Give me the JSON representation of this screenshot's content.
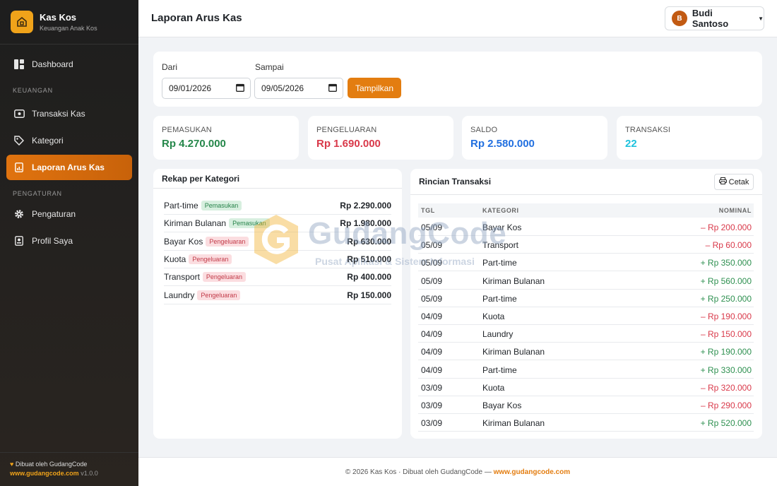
{
  "brand": {
    "name": "Kas Kos",
    "subtitle": "Keuangan Anak Kos"
  },
  "sidebar": {
    "dashboard": "Dashboard",
    "section_keuangan": "KEUANGAN",
    "transaksi": "Transaksi Kas",
    "kategori": "Kategori",
    "laporan": "Laporan Arus Kas",
    "section_pengaturan": "PENGATURAN",
    "pengaturan": "Pengaturan",
    "profil": "Profil Saya",
    "footer_made": "Dibuat oleh GudangCode",
    "footer_link": "www.gudangcode.com",
    "footer_version": "v1.0.0"
  },
  "topbar": {
    "title": "Laporan Arus Kas",
    "user_initial": "B",
    "user_name": "Budi Santoso"
  },
  "filter": {
    "from_label": "Dari",
    "from_value": "09/01/2026",
    "to_label": "Sampai",
    "to_value": "09/05/2026",
    "button": "Tampilkan"
  },
  "stats": {
    "pemasukan_label": "PEMASUKAN",
    "pemasukan_value": "Rp 4.270.000",
    "pengeluaran_label": "PENGELUARAN",
    "pengeluaran_value": "Rp 1.690.000",
    "saldo_label": "SALDO",
    "saldo_value": "Rp 2.580.000",
    "transaksi_label": "TRANSAKSI",
    "transaksi_value": "22"
  },
  "colors": {
    "green": "#25874a",
    "red": "#d9394a",
    "blue": "#2270e0",
    "cyan": "#1fc2dd",
    "accent": "#e37d10"
  },
  "rekap": {
    "title": "Rekap per Kategori",
    "rows": [
      {
        "name": "Part-time",
        "type": "Pemasukan",
        "amount": "Rp 2.290.000"
      },
      {
        "name": "Kiriman Bulanan",
        "type": "Pemasukan",
        "amount": "Rp 1.980.000"
      },
      {
        "name": "Bayar Kos",
        "type": "Pengeluaran",
        "amount": "Rp 630.000"
      },
      {
        "name": "Kuota",
        "type": "Pengeluaran",
        "amount": "Rp 510.000"
      },
      {
        "name": "Transport",
        "type": "Pengeluaran",
        "amount": "Rp 400.000"
      },
      {
        "name": "Laundry",
        "type": "Pengeluaran",
        "amount": "Rp 150.000"
      }
    ]
  },
  "rincian": {
    "title": "Rincian Transaksi",
    "print": "Cetak",
    "col_tgl": "TGL",
    "col_kategori": "KATEGORI",
    "col_nominal": "NOMINAL",
    "rows": [
      {
        "tgl": "05/09",
        "kategori": "Bayar Kos",
        "nominal": "– Rp 200.000",
        "sign": "neg"
      },
      {
        "tgl": "05/09",
        "kategori": "Transport",
        "nominal": "– Rp 60.000",
        "sign": "neg"
      },
      {
        "tgl": "05/09",
        "kategori": "Part-time",
        "nominal": "+ Rp 350.000",
        "sign": "pos"
      },
      {
        "tgl": "05/09",
        "kategori": "Kiriman Bulanan",
        "nominal": "+ Rp 560.000",
        "sign": "pos"
      },
      {
        "tgl": "05/09",
        "kategori": "Part-time",
        "nominal": "+ Rp 250.000",
        "sign": "pos"
      },
      {
        "tgl": "04/09",
        "kategori": "Kuota",
        "nominal": "– Rp 190.000",
        "sign": "neg"
      },
      {
        "tgl": "04/09",
        "kategori": "Laundry",
        "nominal": "– Rp 150.000",
        "sign": "neg"
      },
      {
        "tgl": "04/09",
        "kategori": "Kiriman Bulanan",
        "nominal": "+ Rp 190.000",
        "sign": "pos"
      },
      {
        "tgl": "04/09",
        "kategori": "Part-time",
        "nominal": "+ Rp 330.000",
        "sign": "pos"
      },
      {
        "tgl": "03/09",
        "kategori": "Kuota",
        "nominal": "– Rp 320.000",
        "sign": "neg"
      },
      {
        "tgl": "03/09",
        "kategori": "Bayar Kos",
        "nominal": "– Rp 290.000",
        "sign": "neg"
      },
      {
        "tgl": "03/09",
        "kategori": "Kiriman Bulanan",
        "nominal": "+ Rp 520.000",
        "sign": "pos"
      }
    ]
  },
  "footer": {
    "text": "© 2026 Kas Kos · Dibuat oleh GudangCode — ",
    "link": "www.gudangcode.com"
  },
  "watermark": {
    "title": "GudangCode",
    "subtitle": "Pusat Aplikasi & Sistem Informasi"
  }
}
